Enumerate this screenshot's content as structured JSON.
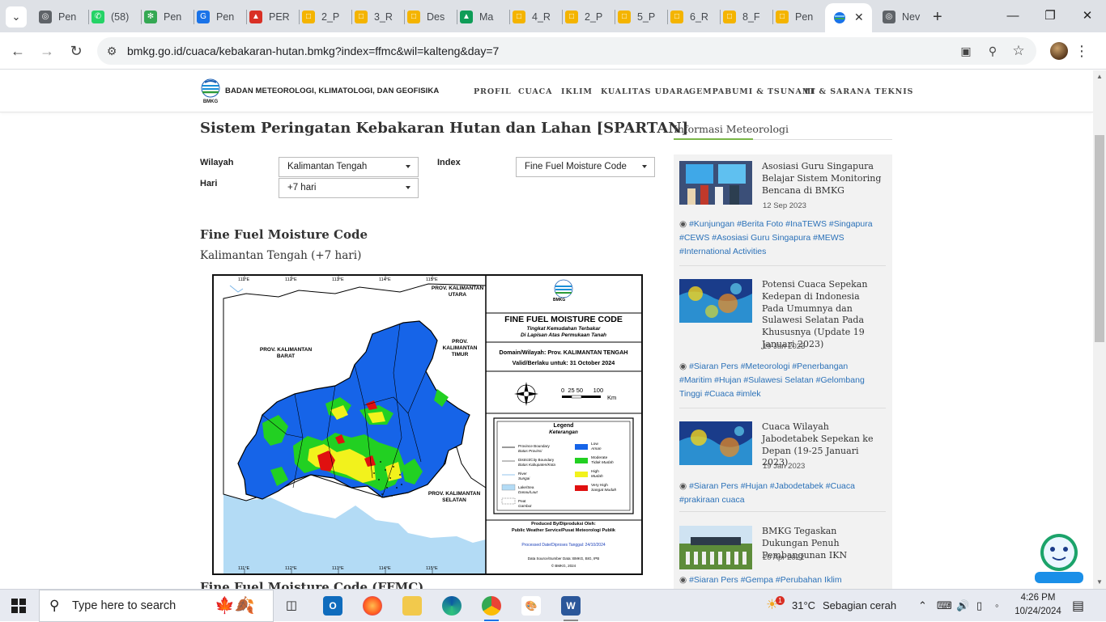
{
  "browser": {
    "tabs": [
      {
        "label": "Pen",
        "color": "#5f6368",
        "glyph": "◎"
      },
      {
        "label": "(58)",
        "color": "#25d366",
        "glyph": "✆"
      },
      {
        "label": "Pen",
        "color": "#34a853",
        "glyph": "✻"
      },
      {
        "label": "Pen",
        "color": "#1a73e8",
        "glyph": "G"
      },
      {
        "label": "PER",
        "color": "#d93025",
        "glyph": "▲"
      },
      {
        "label": "2_P",
        "color": "#f4b400",
        "glyph": "□"
      },
      {
        "label": "3_R",
        "color": "#f4b400",
        "glyph": "□"
      },
      {
        "label": "Des",
        "color": "#f4b400",
        "glyph": "□"
      },
      {
        "label": "Ma",
        "color": "#0f9d58",
        "glyph": "▲"
      },
      {
        "label": "4_R",
        "color": "#f4b400",
        "glyph": "□"
      },
      {
        "label": "2_P",
        "color": "#f4b400",
        "glyph": "□"
      },
      {
        "label": "5_P",
        "color": "#f4b400",
        "glyph": "□"
      },
      {
        "label": "6_R",
        "color": "#f4b400",
        "glyph": "□"
      },
      {
        "label": "8_F",
        "color": "#f4b400",
        "glyph": "□"
      },
      {
        "label": "Pen",
        "color": "#f4b400",
        "glyph": "□"
      },
      {
        "label": "",
        "color": "#1a73e8",
        "glyph": "≡"
      },
      {
        "label": "Nev",
        "color": "#5f6368",
        "glyph": "◎"
      }
    ],
    "url": "bmkg.go.id/cuaca/kebakaran-hutan.bmkg?index=ffmc&wil=kalteng&day=7"
  },
  "site": {
    "org_name": "BADAN METEOROLOGI, KLIMATOLOGI, DAN GEOFISIKA",
    "menu": [
      "PROFIL",
      "CUACA",
      "IKLIM",
      "KUALITAS UDARA",
      "GEMPABUMI & TSUNAMI",
      "IT & SARANA TEKNIS"
    ]
  },
  "main": {
    "title": "Sistem Peringatan Kebakaran Hutan dan Lahan [SPARTAN]",
    "form": {
      "wilayah_label": "Wilayah",
      "wilayah_value": "Kalimantan Tengah",
      "index_label": "Index",
      "index_value": "Fine Fuel Moisture Code",
      "hari_label": "Hari",
      "hari_value": "+7 hari"
    },
    "heading": "Fine Fuel Moisture Code",
    "subheading": "Kalimantan Tengah (+7 hari)",
    "next_heading": "Fine Fuel Moisture Code (FFMC)"
  },
  "map": {
    "lon_ticks": [
      "111°E",
      "112°E",
      "113°E",
      "114°E",
      "115°E"
    ],
    "lat_ticks": [
      "1°S",
      "1°S",
      "2°S",
      "3°S",
      "4°S",
      "5°S"
    ],
    "provinces": [
      "PROV. KALIMANTAN UTARA",
      "PROV. KALIMANTAN TIMUR",
      "PROV. KALIMANTAN BARAT",
      "PROV. KALIMANTAN SELATAN"
    ],
    "brand": "BMKG",
    "title": "FINE FUEL MOISTURE CODE",
    "subtitle1": "Tingkat Kemudahan Terbakar",
    "subtitle2": "Di Lapisan Atas Permukaan Tanah",
    "domain": "Domain/Wilayah: Prov. KALIMANTAN TENGAH",
    "valid": "Valid/Berlaku untuk: 31 October 2024",
    "scale_label": "0  25 50      100",
    "scale_unit": "Km",
    "legend_title": "Legend",
    "legend_subtitle": "Keterangan",
    "legend_lines": [
      "Province Boundary",
      "Batas Provinsi",
      "District/City Boundary",
      "Batas Kabupaten/Kota",
      "River",
      "Sungai",
      "Lake/Sea",
      "Danau/Laut",
      "Peat",
      "Gambut"
    ],
    "legend_classes": [
      {
        "label": "Low",
        "sub": "Aman",
        "color": "#1664e8"
      },
      {
        "label": "Moderate",
        "sub": "Tidak Mudah",
        "color": "#22d022"
      },
      {
        "label": "High",
        "sub": "Mudah",
        "color": "#f2f21c"
      },
      {
        "label": "Very High",
        "sub": "Sangat Mudah",
        "color": "#e01010"
      }
    ],
    "produced_by": "Produced By/Diproduksi Oleh:",
    "produced_org": "Public Weather Service/Pusat Meteorologi Publik",
    "processed": "Processed Date/Diproses Tanggal: 24/10/2024",
    "source": "Data Source/Sumber Data: BMKG, BIG, IPB",
    "copyright": "© BMKG, 2024"
  },
  "sidebar": {
    "title": "Informasi Meteorologi",
    "news": [
      {
        "title": "Asosiasi Guru Singapura Belajar Sistem Monitoring Bencana di BMKG",
        "date": "12 Sep 2023",
        "tags": "#Kunjungan #Berita Foto #InaTEWS #Singapura #CEWS #Asosiasi Guru Singapura #MEWS #International Activities"
      },
      {
        "title": "Potensi Cuaca Sepekan Kedepan di Indonesia Pada Umumnya dan Sulawesi Selatan Pada Khususnya (Update 19 Januari 2023)",
        "date": "19 Jan 2023",
        "tags": "#Siaran Pers #Meteorologi #Penerbangan #Maritim #Hujan #Sulawesi Selatan #Gelombang Tinggi #Cuaca #imlek"
      },
      {
        "title": "Cuaca Wilayah Jabodetabek Sepekan ke Depan (19-25 Januari 2023)",
        "date": "19 Jan 2023",
        "tags": "#Siaran Pers #Hujan #Jabodetabek #Cuaca #prakiraan cuaca"
      },
      {
        "title": "BMKG Tegaskan Dukungan Penuh Pembangunan IKN",
        "date": "20 Apr 2022",
        "tags": "#Siaran Pers #Gempa #Perubahan Iklim"
      }
    ]
  },
  "taskbar": {
    "search_placeholder": "Type here to search",
    "weather_temp": "31°C",
    "weather_text": "Sebagian cerah",
    "time": "4:26 PM",
    "date": "10/24/2024",
    "weather_badge": "1"
  }
}
